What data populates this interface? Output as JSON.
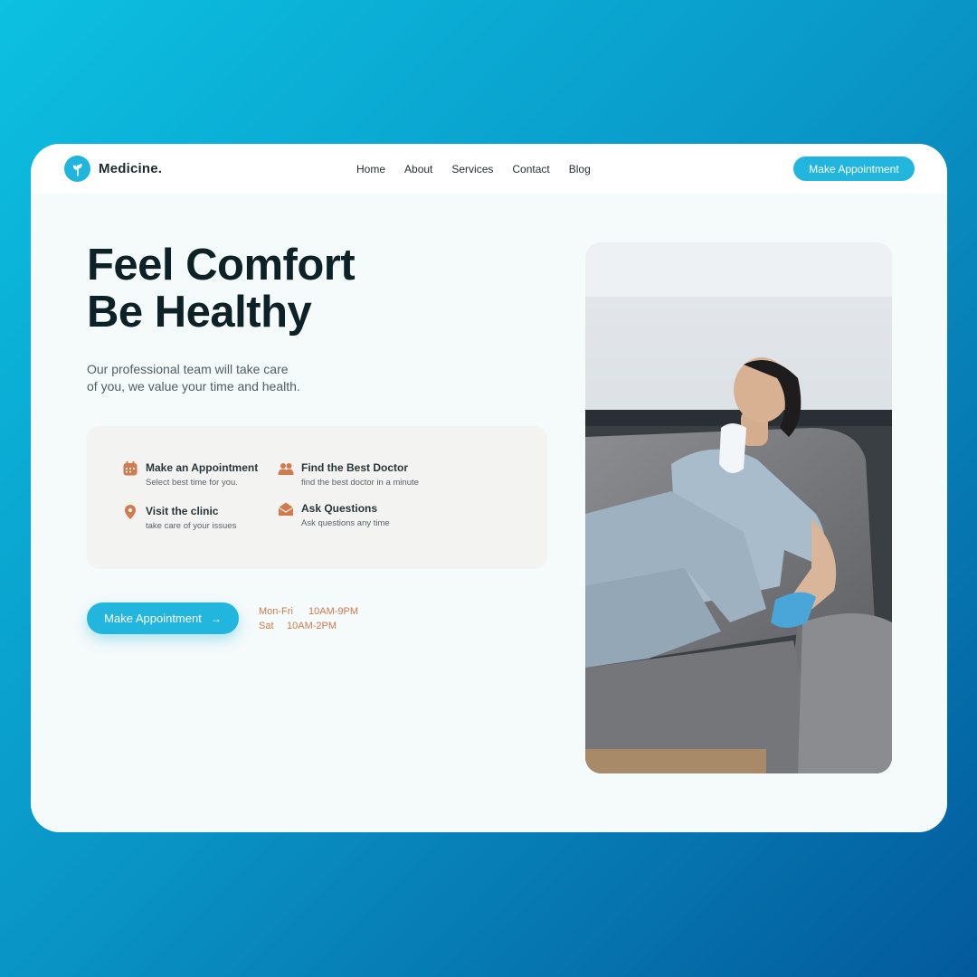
{
  "brand": {
    "name": "Medicine.",
    "accent": "#22b6de",
    "text_dark": "#0d2226",
    "orange": "#d07a4d"
  },
  "nav": {
    "links": [
      "Home",
      "About",
      "Services",
      "Contact",
      "Blog"
    ],
    "cta": "Make Appointment"
  },
  "hero": {
    "title_line1": "Feel Comfort",
    "title_line2": "Be Healthy",
    "subtitle_line1": "Our professional team will take care",
    "subtitle_line2": "of you, we value your time and health."
  },
  "features": [
    {
      "icon": "calendar-icon",
      "title": "Make an Appointment",
      "desc": "Select best time for you."
    },
    {
      "icon": "doctors-icon",
      "title": "Find the Best Doctor",
      "desc": "find the best doctor in a minute"
    },
    {
      "icon": "location-pin-icon",
      "title": "Visit the clinic",
      "desc": "take care of your issues"
    },
    {
      "icon": "mail-icon",
      "title": "Ask Questions",
      "desc": "Ask questions any time"
    }
  ],
  "cta": {
    "label": "Make Appointment",
    "icon": "arrow-right-icon"
  },
  "hours": [
    {
      "days": "Mon-Fri",
      "time": "10AM-9PM"
    },
    {
      "days": "Sat",
      "time": "10AM-2PM"
    }
  ]
}
